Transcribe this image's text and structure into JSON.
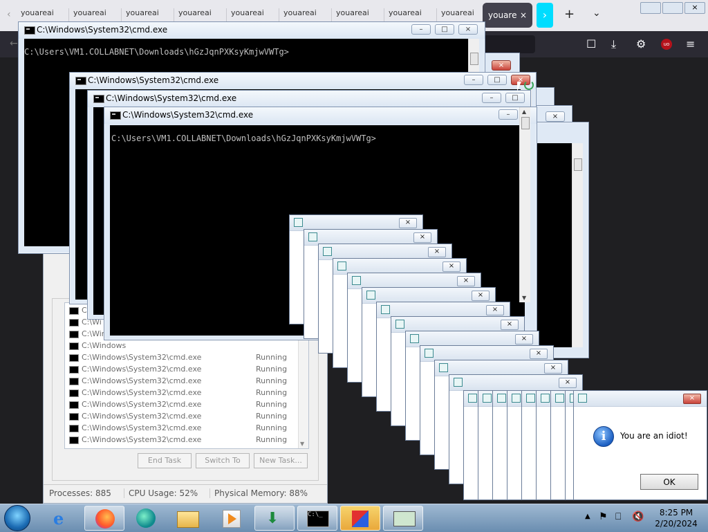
{
  "browser": {
    "tab_label": "youareai",
    "tab_count": 9,
    "active_tab": "youare",
    "active_close": "×"
  },
  "back_cmd": {
    "title": "C:\\Windows\\System32\\cmd.exe",
    "prompt": "C:\\Users\\VM1.COLLABNET\\Downloads\\hGzJqnPXKsyKmjwVWTg>"
  },
  "mid_cmd": {
    "title": "C:\\Windows\\System32\\cmd.exe"
  },
  "mid_cmd2": {
    "title": "C:\\Windows\\System32\\cmd.exe"
  },
  "front_cmd": {
    "title": "C:\\Windows\\System32\\cmd.exe",
    "prompt": "C:\\Users\\VM1.COLLABNET\\Downloads\\hGzJqnPXKsyKmjwVWTg>"
  },
  "taskmgr": {
    "rows": [
      {
        "name": "C:\\Wi",
        "status": ""
      },
      {
        "name": "C:\\Wi",
        "status": ""
      },
      {
        "name": "C:\\Win",
        "status": ""
      },
      {
        "name": "C:\\Windows",
        "status": ""
      },
      {
        "name": "C:\\Windows\\System32\\cmd.exe",
        "status": "Running"
      },
      {
        "name": "C:\\Windows\\System32\\cmd.exe",
        "status": "Running"
      },
      {
        "name": "C:\\Windows\\System32\\cmd.exe",
        "status": "Running"
      },
      {
        "name": "C:\\Windows\\System32\\cmd.exe",
        "status": "Running"
      },
      {
        "name": "C:\\Windows\\System32\\cmd.exe",
        "status": "Running"
      },
      {
        "name": "C:\\Windows\\System32\\cmd.exe",
        "status": "Running"
      },
      {
        "name": "C:\\Windows\\System32\\cmd.exe",
        "status": "Running"
      },
      {
        "name": "C:\\Windows\\System32\\cmd.exe",
        "status": "Running"
      }
    ],
    "end_task": "End Task",
    "switch_to": "Switch To",
    "new_task": "New Task...",
    "processes": "Processes: 885",
    "cpu": "CPU Usage: 52%",
    "memory": "Physical Memory: 88%"
  },
  "dialog": {
    "message": "You are an idiot!",
    "ok_label": "OK",
    "close_glyph": "×"
  },
  "taskbar": {
    "time": "8:25 PM",
    "date": "2/20/2024"
  },
  "colors": {
    "cmd_bg": "#000000",
    "cmd_text": "#c0c0c0",
    "accent_browser": "#00ddff"
  }
}
